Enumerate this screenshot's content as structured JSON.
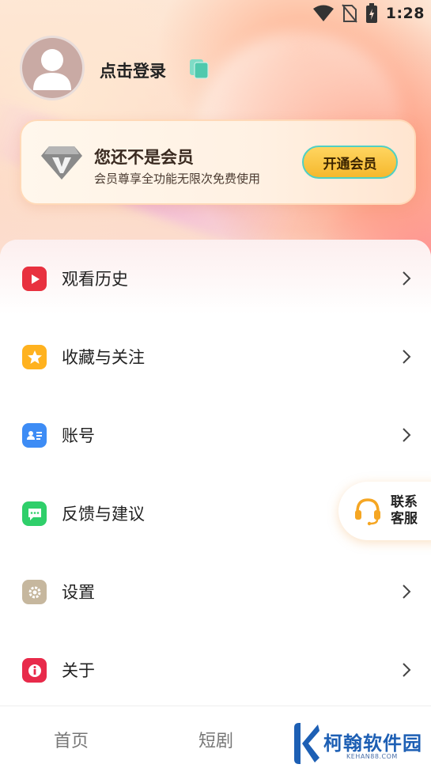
{
  "status_bar": {
    "time": "1:28",
    "icons": [
      "wifi-icon",
      "no-sim-icon",
      "battery-charging-icon"
    ]
  },
  "profile": {
    "login_label": "点击登录",
    "avatar_icon": "user-avatar-icon",
    "copy_icon": "copy-icon"
  },
  "vip": {
    "title": "您还不是会员",
    "subtitle": "会员尊享全功能无限次免费使用",
    "button_label": "开通会员",
    "badge_icon": "diamond-v-badge-icon"
  },
  "menu": {
    "items": [
      {
        "label": "观看历史",
        "icon": "play-icon",
        "color": "#e8313f"
      },
      {
        "label": "收藏与关注",
        "icon": "star-icon",
        "color": "#ffb21f"
      },
      {
        "label": "账号",
        "icon": "account-card-icon",
        "color": "#3d8cf5"
      },
      {
        "label": "反馈与建议",
        "icon": "message-icon",
        "color": "#2fcf6a"
      },
      {
        "label": "设置",
        "icon": "gear-icon",
        "color": "#c6b79e"
      },
      {
        "label": "关于",
        "icon": "info-icon",
        "color": "#e82a4a"
      }
    ]
  },
  "customer_service": {
    "label_line1": "联系",
    "label_line2": "客服",
    "icon": "headset-icon",
    "color": "#f5a623"
  },
  "bottom_nav": {
    "items": [
      {
        "label": "首页"
      },
      {
        "label": "短剧"
      }
    ]
  },
  "watermark": {
    "text": "柯翰软件园",
    "sub": "KEHAN88.COM",
    "color": "#1d5fb4"
  }
}
